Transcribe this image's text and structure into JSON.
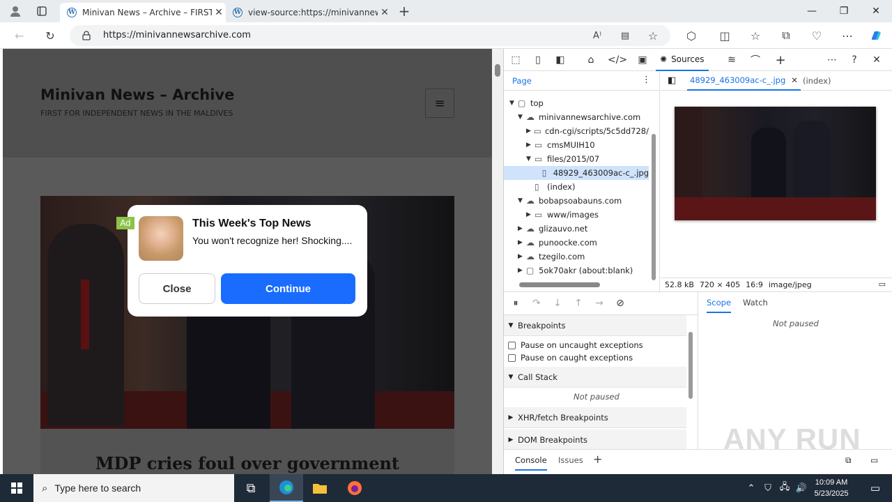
{
  "browser": {
    "tabs": [
      {
        "title": "Minivan News – Archive – FIRST F",
        "active": true
      },
      {
        "title": "view-source:https://minivannew",
        "active": false
      }
    ],
    "url": "https://minivannewsarchive.com"
  },
  "page": {
    "site_title": "Minivan News – Archive",
    "tagline": "FIRST FOR INDEPENDENT NEWS IN THE MALDIVES",
    "article_title": "MDP cries foul over government"
  },
  "ad": {
    "badge": "Ad",
    "title": "This Week's Top News",
    "body": "You won't recognize her! Shocking....",
    "close_label": "Close",
    "continue_label": "Continue"
  },
  "devtools": {
    "active_tool": "Sources",
    "navigator_tab": "Page",
    "tree": [
      {
        "label": "top",
        "indent": 0,
        "arrow": "▼",
        "icon": "frame-icon"
      },
      {
        "label": "minivannewsarchive.com",
        "indent": 1,
        "arrow": "▼",
        "icon": "cloud-icon"
      },
      {
        "label": "cdn-cgi/scripts/5c5dd728/",
        "indent": 2,
        "arrow": "▶",
        "icon": "folder-icon"
      },
      {
        "label": "cmsMUIH10",
        "indent": 2,
        "arrow": "▶",
        "icon": "folder-icon"
      },
      {
        "label": "files/2015/07",
        "indent": 2,
        "arrow": "▼",
        "icon": "folder-icon"
      },
      {
        "label": "48929_463009ac-c_.jpg",
        "indent": 3,
        "arrow": "",
        "icon": "file-icon",
        "selected": true
      },
      {
        "label": "(index)",
        "indent": 2,
        "arrow": "",
        "icon": "file-icon"
      },
      {
        "label": "bobapsoabauns.com",
        "indent": 1,
        "arrow": "▼",
        "icon": "cloud-icon"
      },
      {
        "label": "www/images",
        "indent": 2,
        "arrow": "▶",
        "icon": "folder-icon"
      },
      {
        "label": "glizauvo.net",
        "indent": 1,
        "arrow": "▶",
        "icon": "cloud-icon"
      },
      {
        "label": "punoocke.com",
        "indent": 1,
        "arrow": "▶",
        "icon": "cloud-icon"
      },
      {
        "label": "tzegilo.com",
        "indent": 1,
        "arrow": "▶",
        "icon": "cloud-icon"
      },
      {
        "label": "5ok70akr (about:blank)",
        "indent": 1,
        "arrow": "▶",
        "icon": "frame-icon"
      }
    ],
    "open_file_tab": "48929_463009ac-c_.jpg",
    "index_tab": "(index)",
    "image_info": {
      "size": "52.8 kB",
      "dimensions": "720 × 405",
      "ratio": "16:9",
      "mime": "image/jpeg"
    },
    "breakpoints_label": "Breakpoints",
    "pause_uncaught": "Pause on uncaught exceptions",
    "pause_caught": "Pause on caught exceptions",
    "call_stack_label": "Call Stack",
    "not_paused": "Not paused",
    "xhr_label": "XHR/fetch Breakpoints",
    "dom_label": "DOM Breakpoints",
    "scope_tab": "Scope",
    "watch_tab": "Watch",
    "scope_not_paused": "Not paused",
    "drawer_tabs": [
      "Console",
      "Issues"
    ]
  },
  "taskbar": {
    "search_placeholder": "Type here to search",
    "time": "10:09 AM",
    "date": "5/23/2025"
  },
  "watermark": "ANY RUN",
  "colors": {
    "accent": "#1a73e8",
    "ad_button": "#1a6cff",
    "ad_badge": "#8bc34a",
    "taskbar": "#1f2a38"
  }
}
